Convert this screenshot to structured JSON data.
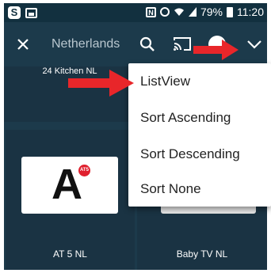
{
  "status_bar": {
    "battery": "79%",
    "time": "11:20",
    "icons": [
      "skype-icon",
      "image-notification-icon",
      "nfc-icon",
      "alarm-icon",
      "wifi-icon",
      "signal-icon",
      "battery-icon"
    ]
  },
  "appbar": {
    "title": "Netherlands",
    "icons": [
      "close-icon",
      "search-icon",
      "cast-icon",
      "avatar",
      "chevron-down-icon"
    ]
  },
  "channels": {
    "top": "24 Kitchen NL",
    "left": "AT 5 NL",
    "right": "Baby TV NL",
    "logo_letter": "A",
    "logo_badge": "AT5"
  },
  "menu": {
    "items": [
      "ListView",
      "Sort Ascending",
      "Sort Descending",
      "Sort None"
    ]
  },
  "colors": {
    "background": "#1c3a4b",
    "status_bar": "#12303f",
    "annotation_arrow": "#e8262a"
  }
}
